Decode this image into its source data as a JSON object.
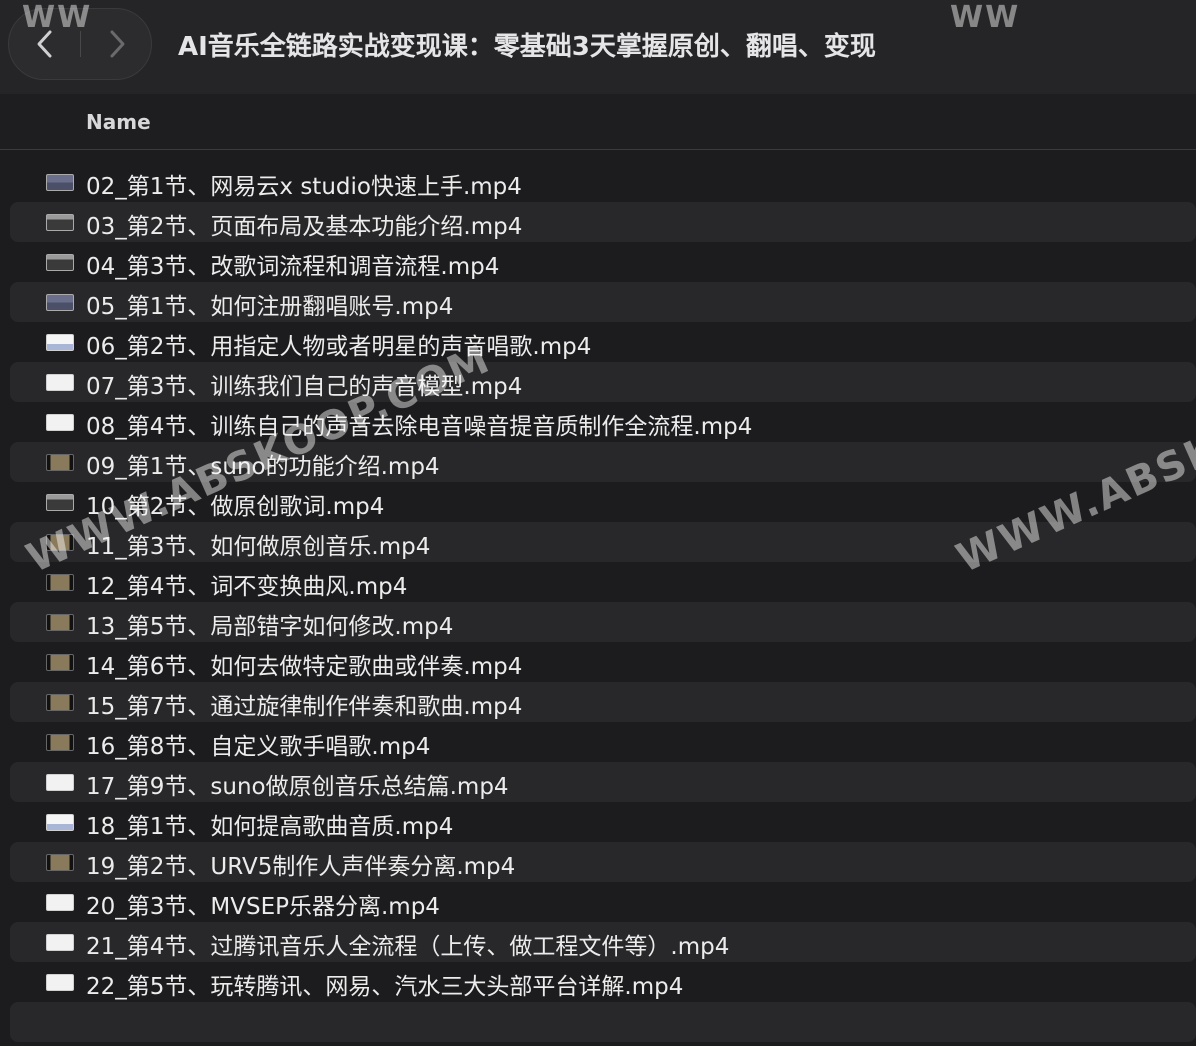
{
  "window": {
    "title": "AI音乐全链路实战变现课：零基础3天掌握原创、翻唱、变现"
  },
  "navigation": {
    "back_icon": "chevron-left-icon",
    "forward_icon": "chevron-right-icon"
  },
  "columns": {
    "name": "Name"
  },
  "files": [
    {
      "name": "02_第1节、网易云x studio快速上手.mp4",
      "thumb": "t-blue"
    },
    {
      "name": "03_第2节、页面布局及基本功能介绍.mp4",
      "thumb": "t-gray"
    },
    {
      "name": "04_第3节、改歌词流程和调音流程.mp4",
      "thumb": "t-gray"
    },
    {
      "name": "05_第1节、如何注册翻唱账号.mp4",
      "thumb": "t-blue"
    },
    {
      "name": "06_第2节、用指定人物或者明星的声音唱歌.mp4",
      "thumb": "t-light"
    },
    {
      "name": "07_第3节、训练我们自己的声音模型.mp4",
      "thumb": "t-white"
    },
    {
      "name": "08_第4节、训练自己的声音去除电音噪音提音质制作全流程.mp4",
      "thumb": "t-white"
    },
    {
      "name": "09_第1节、suno的功能介绍.mp4",
      "thumb": "t-dark"
    },
    {
      "name": "10_第2节、做原创歌词.mp4",
      "thumb": "t-gray"
    },
    {
      "name": "11_第3节、如何做原创音乐.mp4",
      "thumb": "t-dark"
    },
    {
      "name": "12_第4节、词不变换曲风.mp4",
      "thumb": "t-dark"
    },
    {
      "name": "13_第5节、局部错字如何修改.mp4",
      "thumb": "t-dark"
    },
    {
      "name": "14_第6节、如何去做特定歌曲或伴奏.mp4",
      "thumb": "t-dark"
    },
    {
      "name": "15_第7节、通过旋律制作伴奏和歌曲.mp4",
      "thumb": "t-dark"
    },
    {
      "name": "16_第8节、自定义歌手唱歌.mp4",
      "thumb": "t-dark"
    },
    {
      "name": "17_第9节、suno做原创音乐总结篇.mp4",
      "thumb": "t-white"
    },
    {
      "name": "18_第1节、如何提高歌曲音质.mp4",
      "thumb": "t-light"
    },
    {
      "name": "19_第2节、URV5制作人声伴奏分离.mp4",
      "thumb": "t-dark"
    },
    {
      "name": "20_第3节、MVSEP乐器分离.mp4",
      "thumb": "t-white"
    },
    {
      "name": "21_第4节、过腾讯音乐人全流程（上传、做工程文件等）.mp4",
      "thumb": "t-white"
    },
    {
      "name": "22_第5节、玩转腾讯、网易、汽水三大头部平台详解.mp4",
      "thumb": "t-white"
    }
  ],
  "watermarks": [
    "WWW.ABSKOOP.COM",
    "WWW.ABSKO",
    "WW",
    "WW"
  ]
}
